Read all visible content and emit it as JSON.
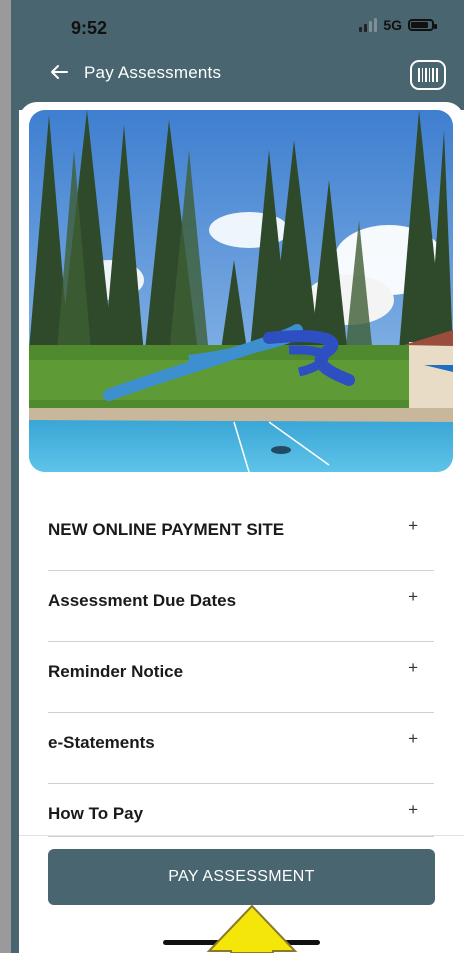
{
  "status": {
    "time": "9:52",
    "network": "5G"
  },
  "header": {
    "title": "Pay Assessments",
    "back_icon": "arrow-left-icon",
    "right_icon": "barcode-scan-icon"
  },
  "hero": {
    "description_icon": "pool-waterslide-photo"
  },
  "accordion": {
    "items": [
      {
        "label": "NEW ONLINE PAYMENT SITE",
        "icon": "+"
      },
      {
        "label": "Assessment Due Dates",
        "icon": "+"
      },
      {
        "label": "Reminder Notice",
        "icon": "+"
      },
      {
        "label": "e-Statements",
        "icon": "+"
      },
      {
        "label": "How To Pay",
        "icon": "+"
      }
    ]
  },
  "actions": {
    "pay_label": "PAY ASSESSMENT"
  },
  "colors": {
    "brand": "#486570",
    "annotation_arrow": "#f5e60a"
  }
}
